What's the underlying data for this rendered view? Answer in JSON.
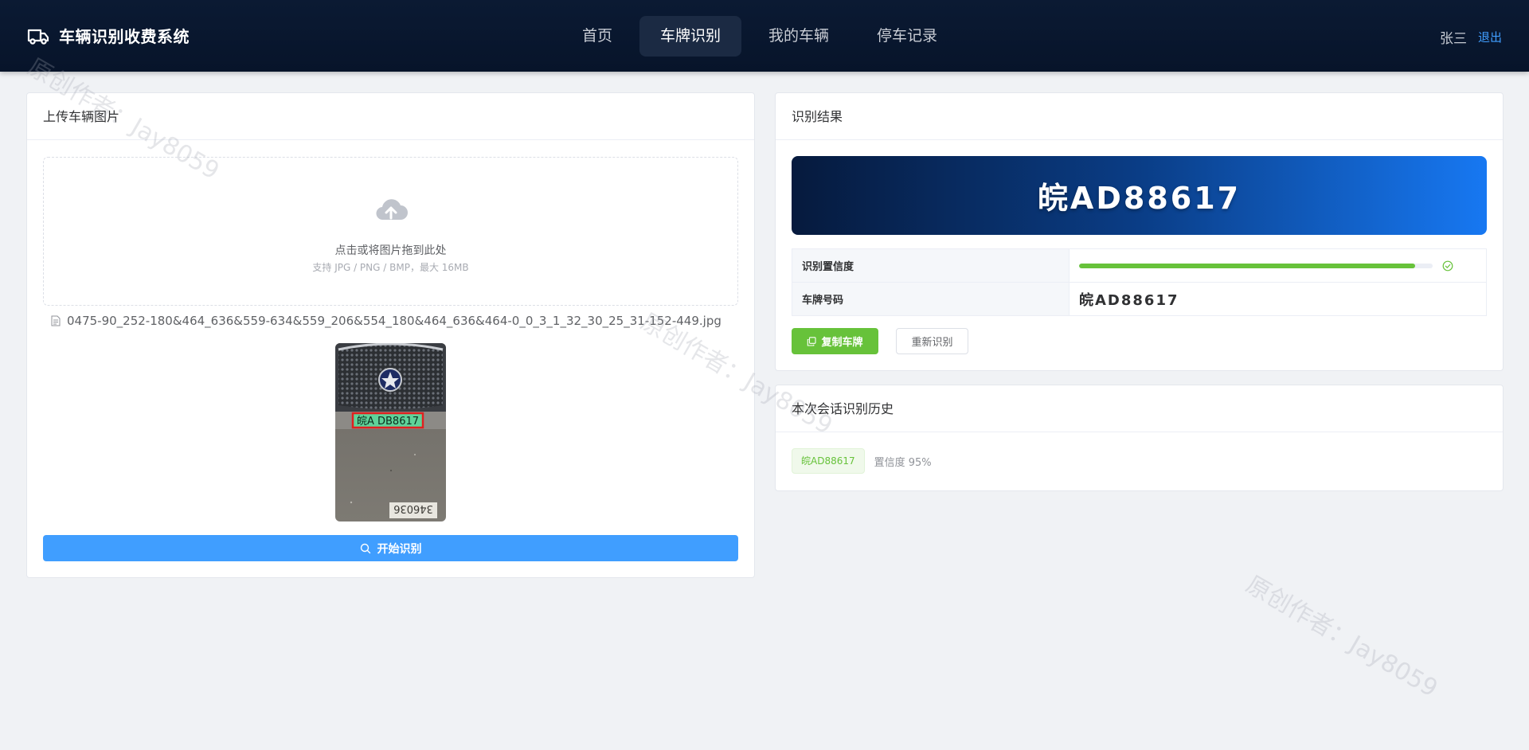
{
  "header": {
    "brand_title": "车辆识别收费系统",
    "nav": [
      {
        "label": "首页",
        "active": false
      },
      {
        "label": "车牌识别",
        "active": true
      },
      {
        "label": "我的车辆",
        "active": false
      },
      {
        "label": "停车记录",
        "active": false
      }
    ],
    "user_name": "张三",
    "logout_label": "退出"
  },
  "upload_card": {
    "title": "上传车辆图片",
    "drop_text": "点击或将图片拖到此处",
    "drop_tip": "支持 JPG / PNG / BMP，最大 16MB",
    "file_name": "0475-90_252-180&464_636&559-634&559_206&554_180&464_636&464-0_0_3_1_32_30_25_31-152-449.jpg",
    "preview_plate_text": "皖A DB8617",
    "preview_ground_text": "346036",
    "start_button": "开始识别"
  },
  "result_card": {
    "title": "识别结果",
    "plate": "皖AD88617",
    "confidence_label": "识别置信度",
    "confidence_fraction": 0.95,
    "plate_label": "车牌号码",
    "plate_value": "皖AD88617",
    "copy_button": "复制车牌",
    "retry_button": "重新识别"
  },
  "history_card": {
    "title": "本次会话识别历史",
    "items": [
      {
        "plate": "皖AD88617",
        "confidence_text": "置信度 95%"
      }
    ]
  },
  "watermark": "原创作者：Jay8059",
  "colors": {
    "header_bg": "#0b1a33",
    "primary": "#409eff",
    "success": "#67c23a"
  }
}
